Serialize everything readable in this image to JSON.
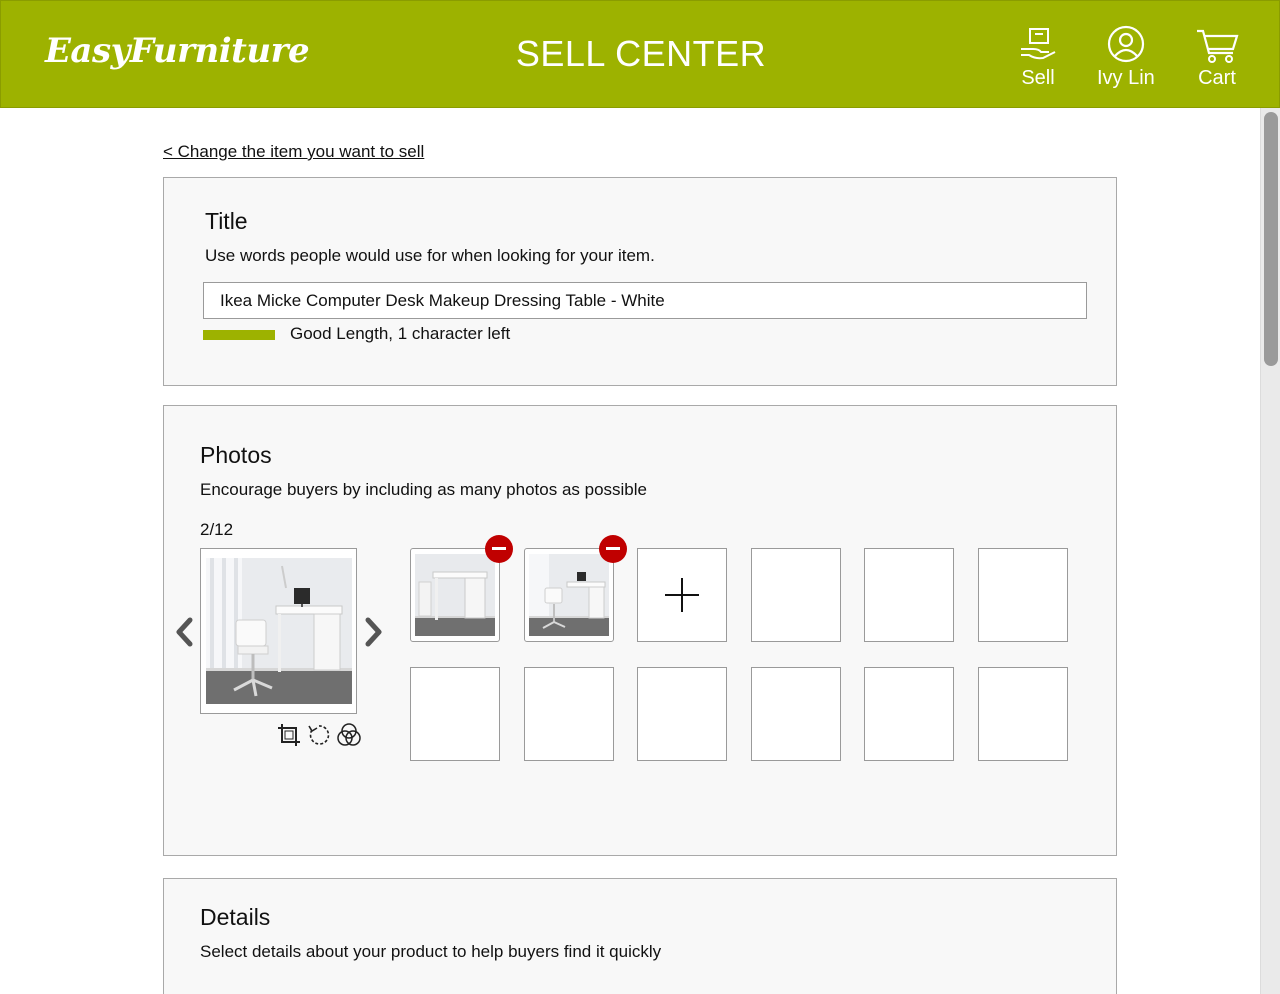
{
  "header": {
    "logo": "EasyFurniture",
    "title": "SELL CENTER",
    "nav": {
      "sell": "Sell",
      "user": "Ivy Lin",
      "cart": "Cart"
    }
  },
  "back_link": "< Change the item you want to sell",
  "title_section": {
    "heading": "Title",
    "instruction": "Use words people would use for when looking for your item.",
    "value": "Ikea Micke Computer Desk  Makeup Dressing Table - White",
    "length_status": "Good Length, 1 character left"
  },
  "photos_section": {
    "heading": "Photos",
    "instruction": "Encourage buyers by including as many photos as possible",
    "count": "2/12"
  },
  "details_section": {
    "heading": "Details",
    "instruction": "Select details about your product to help buyers find it quickly"
  },
  "colors": {
    "brand": "#9db200",
    "remove": "#c00000"
  }
}
